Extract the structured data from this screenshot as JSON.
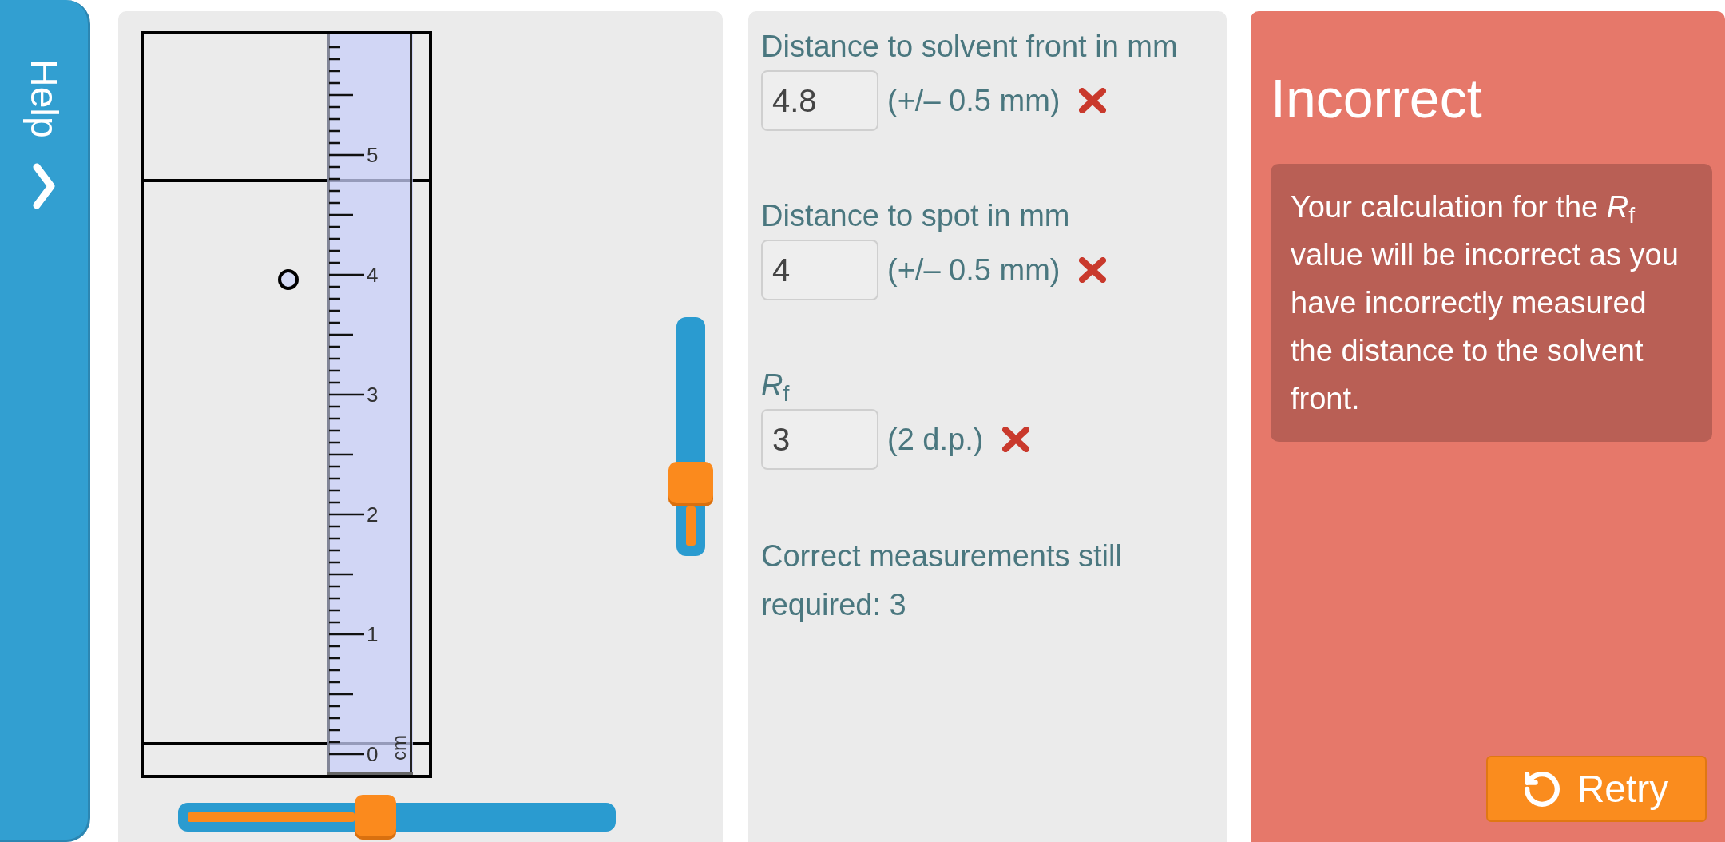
{
  "help_tab": {
    "label": "Help"
  },
  "tlc_plate": {
    "ruler": {
      "labels": [
        "5",
        "4",
        "3",
        "2",
        "1",
        "0"
      ],
      "unit": "cm"
    }
  },
  "vertical_slider": {
    "level": 0.3
  },
  "horizontal_slider": {
    "level": 0.45
  },
  "measurements": [
    {
      "label": "Distance to solvent front in mm",
      "value": "4.8",
      "hint": "(+/– 0.5 mm)",
      "correct": false
    },
    {
      "label": "Distance to spot in mm",
      "value": "4",
      "hint": "(+/– 0.5 mm)",
      "correct": false
    },
    {
      "label": "*R*$_{f}$",
      "value": "3",
      "hint": "(2 d.p.)",
      "correct": false
    }
  ],
  "status": "Correct measurements still required: 3",
  "feedback": {
    "correct": false,
    "title": "Incorrect",
    "message": "Your calculation for the *R*$_{f}$ value will be incorrect as you have incorrectly measured the distance to the solvent front.",
    "retry_button": "Retry"
  }
}
